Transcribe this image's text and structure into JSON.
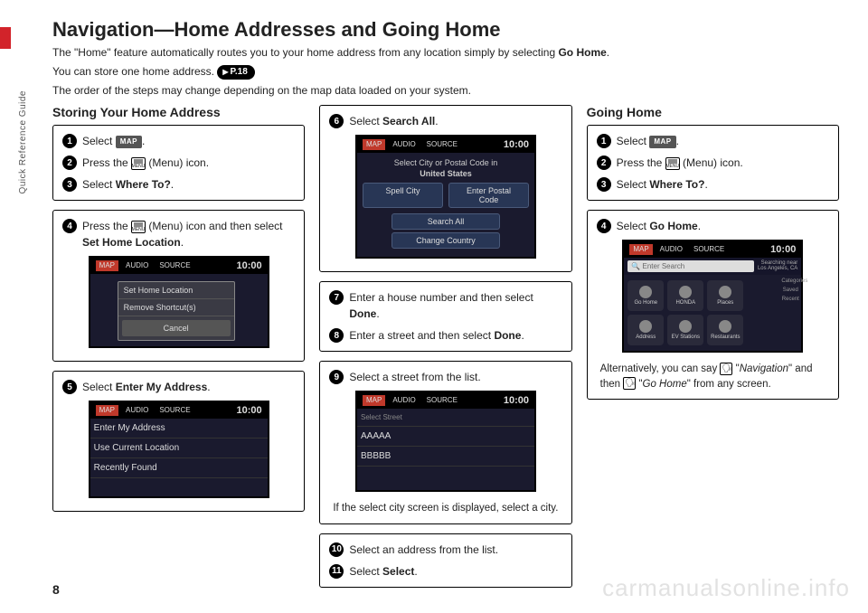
{
  "page_number": "8",
  "side_label": "Quick Reference Guide",
  "watermark": "carmanualsonline.info",
  "title": "Navigation—Home Addresses and Going Home",
  "intro": {
    "p1a": "The \"Home\" feature automatically routes you to your home address from any location simply by selecting ",
    "p1b": "Go Home",
    "p1c": ".",
    "p2a": "You can store one home address. ",
    "pref": "P.18",
    "p3": "The order of the steps may change depending on the map data loaded on your system."
  },
  "col1": {
    "heading": "Storing Your Home Address",
    "s1a": "Select ",
    "s1b": ".",
    "map_label": "MAP",
    "s2a": "Press the ",
    "s2b": " (Menu) icon.",
    "menu_label": "MENU",
    "s3a": "Select ",
    "s3b": "Where To?",
    "s3c": ".",
    "s4a": "Press the ",
    "s4b": " (Menu) icon and then select ",
    "s4c": "Set Home Location",
    "s4d": ".",
    "s5a": "Select ",
    "s5b": "Enter My Address",
    "s5c": "."
  },
  "screen4": {
    "tabs": [
      "MAP",
      "AUDIO",
      "SOURCE"
    ],
    "time": "10:00",
    "popup1": "Set Home Location",
    "popup2": "Remove Shortcut(s)",
    "cancel": "Cancel"
  },
  "screen5": {
    "tabs": [
      "MAP",
      "AUDIO",
      "SOURCE"
    ],
    "time": "10:00",
    "rows": [
      "Enter My Address",
      "Use Current Location",
      "Recently Found"
    ]
  },
  "col2": {
    "s6a": "Select ",
    "s6b": "Search All",
    "s6c": ".",
    "s7a": "Enter a house number and then select ",
    "s7b": "Done",
    "s7c": ".",
    "s8a": "Enter a street and then select ",
    "s8b": "Done",
    "s8c": ".",
    "s9": "Select a street from the list.",
    "s9cap": "If the select city screen is displayed, select a city.",
    "s10": "Select an address from the list.",
    "s11a": "Select ",
    "s11b": "Select",
    "s11c": "."
  },
  "screen6": {
    "tabs": [
      "MAP",
      "AUDIO",
      "SOURCE"
    ],
    "time": "10:00",
    "top1": "Select City or Postal Code in",
    "top2": "United States",
    "btns": [
      "Spell City",
      "Enter Postal Code",
      "Search All",
      "Change Country"
    ]
  },
  "screen9": {
    "tabs": [
      "MAP",
      "AUDIO",
      "SOURCE"
    ],
    "time": "10:00",
    "header": "Select Street",
    "rows": [
      "AAAAA",
      "BBBBB"
    ]
  },
  "col3": {
    "heading": "Going Home",
    "s1a": "Select ",
    "s1b": ".",
    "s2a": "Press the ",
    "s2b": " (Menu) icon.",
    "s3a": "Select ",
    "s3b": "Where To?",
    "s3c": ".",
    "s4a": "Select ",
    "s4b": "Go Home",
    "s4c": ".",
    "alt1": "Alternatively, you can say ",
    "alt2": " \"",
    "alt3": "Navigation",
    "alt4": "\" and then ",
    "alt5": " \"",
    "alt6": "Go Home",
    "alt7": "\" from any screen."
  },
  "screenGH": {
    "tabs": [
      "MAP",
      "AUDIO",
      "SOURCE"
    ],
    "time": "10:00",
    "search": "Enter Search",
    "loc1": "Searching near",
    "loc2": "Los Angeles, CA",
    "icons": [
      "Go Home",
      "HONDA",
      "Places",
      "Address",
      "EV Stations",
      "Restaurants"
    ],
    "side": [
      "Categories",
      "Saved",
      "Recent"
    ]
  }
}
